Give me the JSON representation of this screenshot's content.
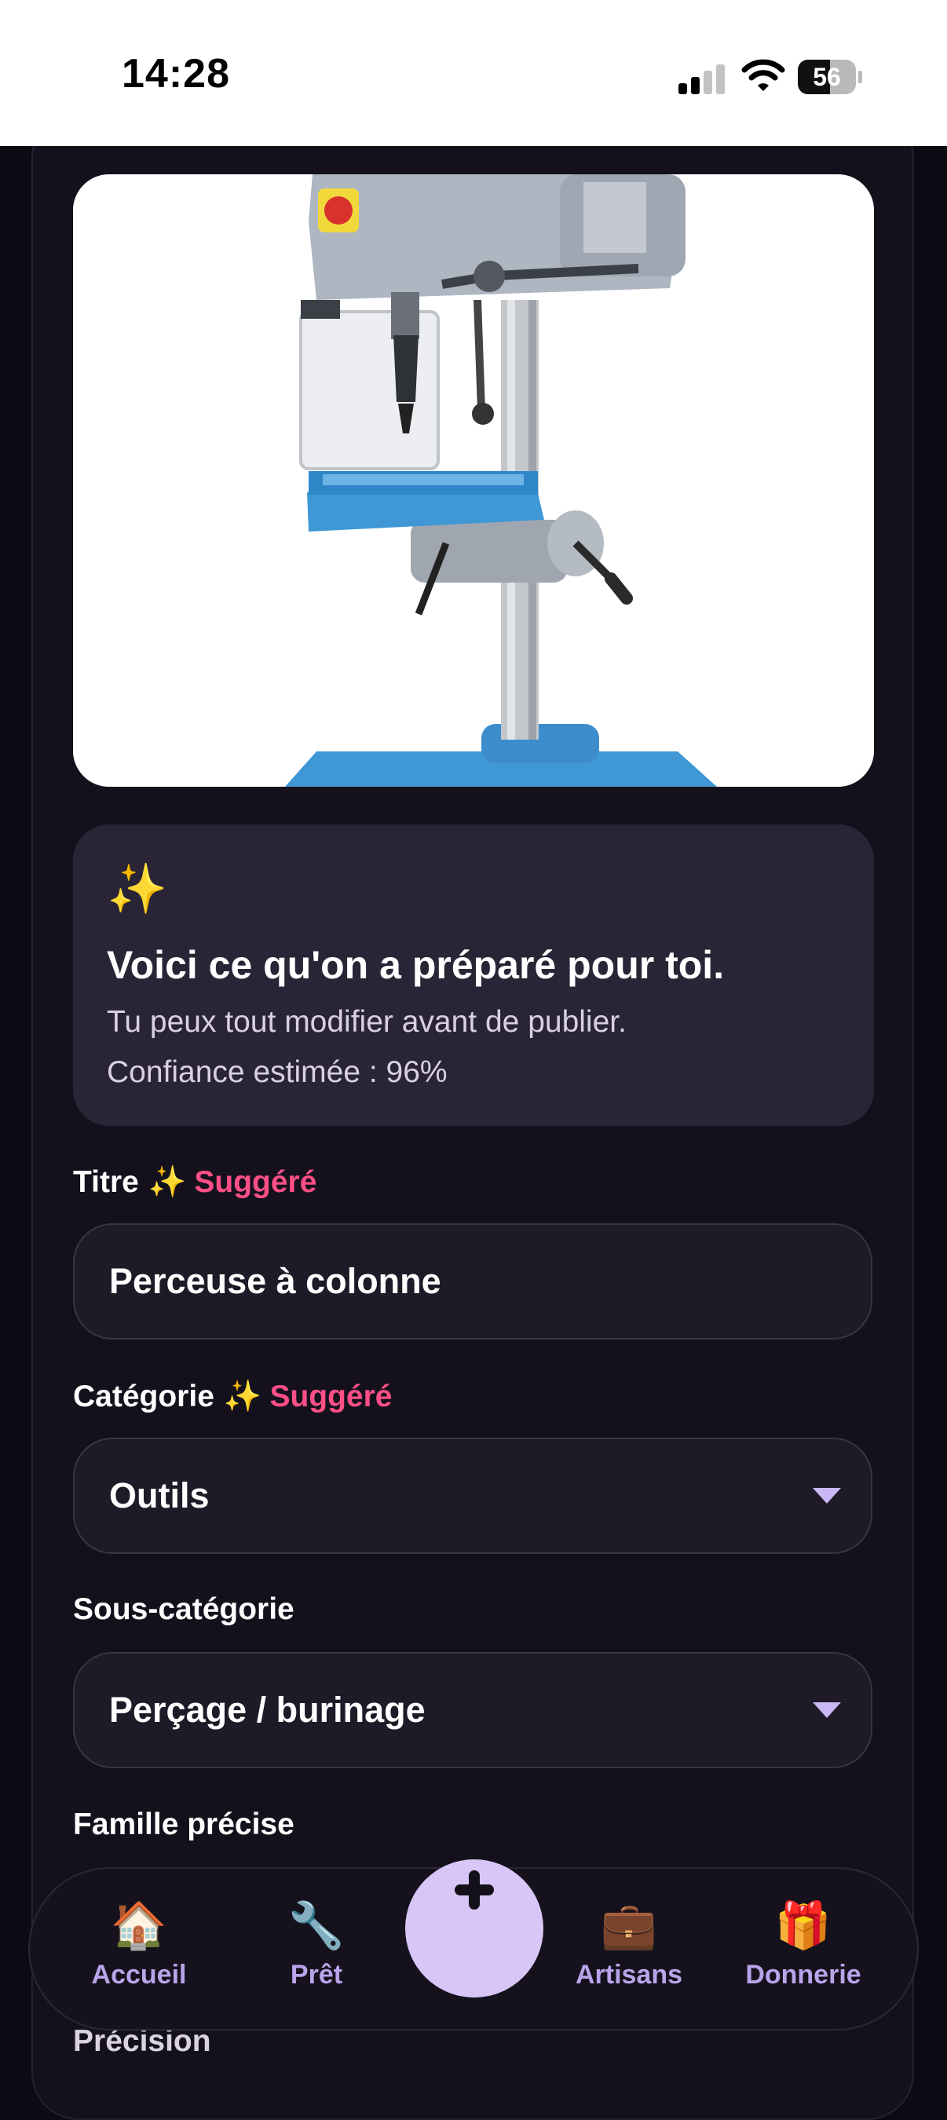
{
  "status_bar": {
    "time": "14:28",
    "battery_level": "56",
    "battery_fraction": 0.56,
    "signal_bars_active": 2,
    "signal_bars_total": 4
  },
  "photo": {
    "subject": "drill-press",
    "colors": {
      "body": "#aeb6c2",
      "table": "#3f97d6",
      "column": "#c4c7cb"
    }
  },
  "ai_card": {
    "icon": "sparkles-icon",
    "sparkle": "✨",
    "title": "Voici ce qu'on a préparé pour toi.",
    "subtitle": "Tu peux tout modifier avant de publier.",
    "confidence": "Confiance estimée : 96%"
  },
  "fields": {
    "title": {
      "label": "Titre",
      "sparkle": "✨",
      "badge": "Suggéré",
      "value": "Perceuse à colonne"
    },
    "category": {
      "label": "Catégorie",
      "sparkle": "✨",
      "badge": "Suggéré",
      "value": "Outils"
    },
    "subcategory": {
      "label": "Sous-catégorie",
      "value": "Perçage / burinage"
    },
    "family": {
      "label": "Famille précise"
    },
    "precision": {
      "label": "Précision"
    }
  },
  "nav": {
    "items": [
      {
        "label": "Accueil",
        "icon": "house-icon",
        "glyph": "🏠"
      },
      {
        "label": "Prêt",
        "icon": "wrench-icon",
        "glyph": "🔧"
      },
      {
        "label": "Artisans",
        "icon": "briefcase-icon",
        "glyph": "💼"
      },
      {
        "label": "Donnerie",
        "icon": "gift-icon",
        "glyph": "🎁"
      }
    ],
    "fab_icon": "plus-icon"
  },
  "colors": {
    "background": "#0d0a14",
    "card": "#2a2536",
    "accent": "#d8c6f7",
    "suggested": "#ff4f86",
    "nav_label": "#b9a4ea"
  }
}
